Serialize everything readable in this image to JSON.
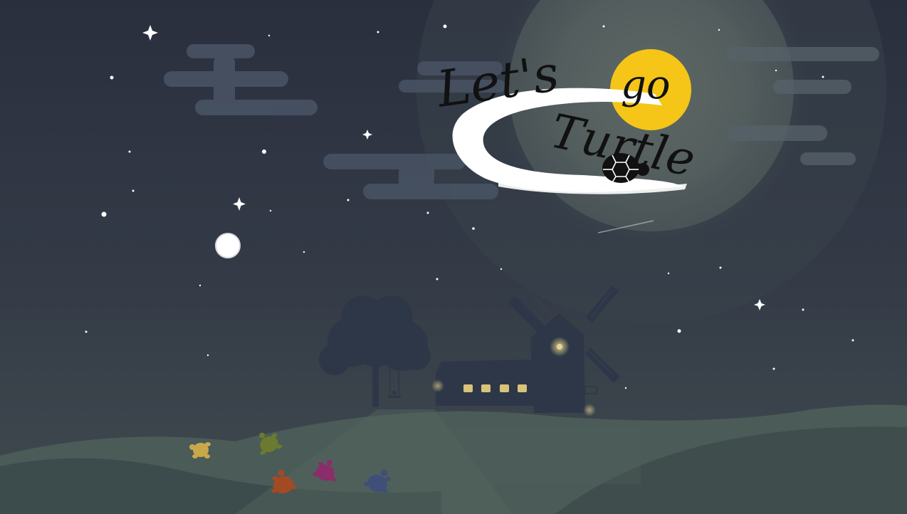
{
  "game": {
    "title_line1": "Let's",
    "title_word2": "go",
    "title_line2": "Turtle"
  },
  "colors": {
    "sky_top": "#2c3140",
    "sky_bottom": "#40484f",
    "moon_glow": "#5b6663",
    "small_moon": "#ffffff",
    "sun_badge": "#f5c518",
    "hill_light": "#4a5a58",
    "hill_dark": "#3b4a4a",
    "silhouette": "#2e3747",
    "window_light": "#d9c27a",
    "turtle_yellow": "#c9a84c",
    "turtle_green": "#6b7a2e",
    "turtle_magenta": "#8a2d6a",
    "turtle_orange": "#a34a24",
    "turtle_blue": "#3f4f7a"
  },
  "icons": {
    "logo_turtle": "turtle-icon",
    "stars": "sparkle-star-icon"
  }
}
